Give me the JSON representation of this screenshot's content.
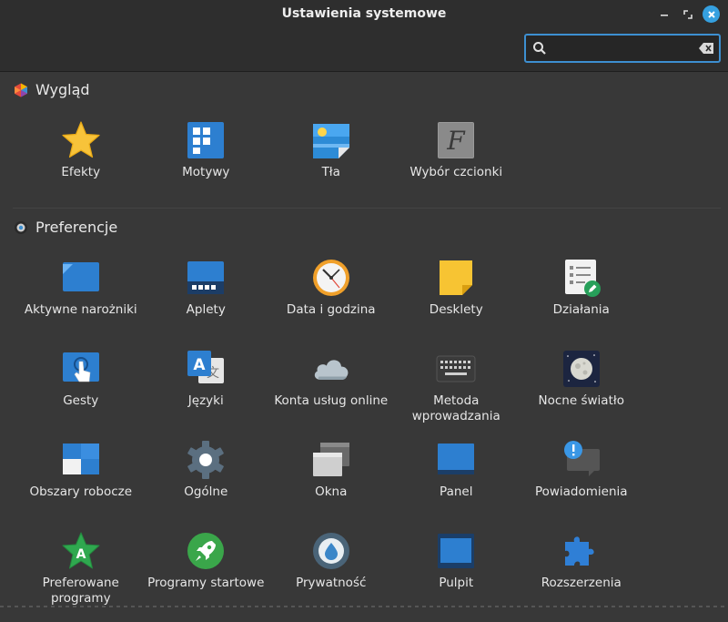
{
  "window": {
    "title": "Ustawienia systemowe"
  },
  "search": {
    "value": "",
    "placeholder": ""
  },
  "sections": [
    {
      "title": "Wygląd",
      "items": [
        {
          "label": "Efekty",
          "icon": "star-icon"
        },
        {
          "label": "Motywy",
          "icon": "themes-icon"
        },
        {
          "label": "Tła",
          "icon": "backgrounds-icon"
        },
        {
          "label": "Wybór czcionki",
          "icon": "font-icon"
        }
      ]
    },
    {
      "title": "Preferencje",
      "items": [
        {
          "label": "Aktywne narożniki",
          "icon": "hot-corners-icon"
        },
        {
          "label": "Aplety",
          "icon": "applets-icon"
        },
        {
          "label": "Data i godzina",
          "icon": "clock-icon"
        },
        {
          "label": "Desklety",
          "icon": "desklets-icon"
        },
        {
          "label": "Działania",
          "icon": "actions-icon"
        },
        {
          "label": "Gesty",
          "icon": "gestures-icon"
        },
        {
          "label": "Języki",
          "icon": "languages-icon"
        },
        {
          "label": "Konta usług online",
          "icon": "cloud-icon"
        },
        {
          "label": "Metoda wprowadzania",
          "icon": "keyboard-icon"
        },
        {
          "label": "Nocne światło",
          "icon": "moon-icon"
        },
        {
          "label": "Obszary robocze",
          "icon": "workspaces-icon"
        },
        {
          "label": "Ogólne",
          "icon": "gear-icon"
        },
        {
          "label": "Okna",
          "icon": "windows-icon"
        },
        {
          "label": "Panel",
          "icon": "panel-icon"
        },
        {
          "label": "Powiadomienia",
          "icon": "notifications-icon"
        },
        {
          "label": "Preferowane programy",
          "icon": "preferred-apps-icon"
        },
        {
          "label": "Programy startowe",
          "icon": "startup-icon"
        },
        {
          "label": "Prywatność",
          "icon": "privacy-icon"
        },
        {
          "label": "Pulpit",
          "icon": "desktop-icon"
        },
        {
          "label": "Rozszerzenia",
          "icon": "extensions-icon"
        }
      ]
    }
  ],
  "colors": {
    "accent": "#3d8fd1",
    "background": "#383838",
    "titlebar": "#2e2e2e"
  }
}
